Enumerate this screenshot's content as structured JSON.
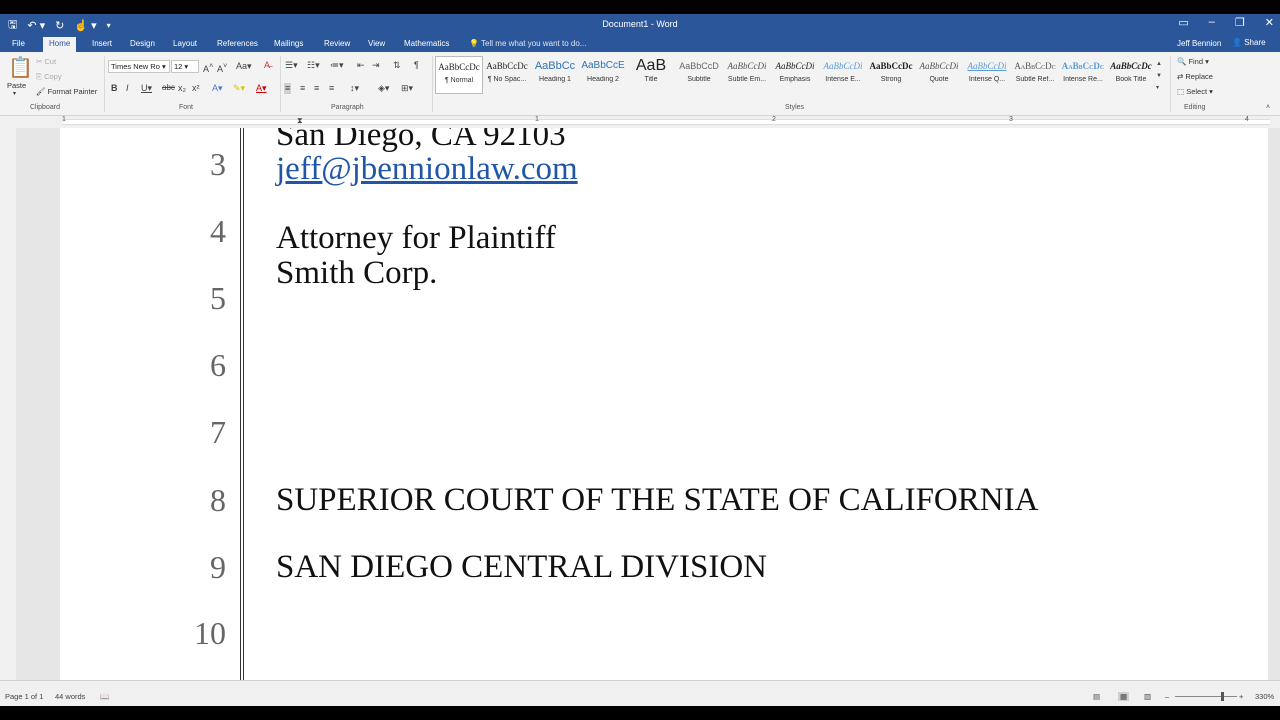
{
  "window": {
    "title": "Document1 - Word"
  },
  "tabs": [
    "File",
    "Home",
    "Insert",
    "Design",
    "Layout",
    "References",
    "Mailings",
    "Review",
    "View",
    "Mathematics"
  ],
  "tell_me": "Tell me what you want to do...",
  "user": "Jeff Bennion",
  "share": "Share",
  "clipboard": {
    "paste": "Paste",
    "cut": "Cut",
    "copy": "Copy",
    "format_painter": "Format Painter",
    "label": "Clipboard"
  },
  "font": {
    "name": "Times New Ro",
    "size": "12",
    "label": "Font"
  },
  "paragraph": {
    "label": "Paragraph"
  },
  "styles": {
    "label": "Styles",
    "items": [
      {
        "preview": "AaBbCcDc",
        "name": "¶ Normal"
      },
      {
        "preview": "AaBbCcDc",
        "name": "¶ No Spac..."
      },
      {
        "preview": "AaBbCc",
        "name": "Heading 1"
      },
      {
        "preview": "AaBbCcE",
        "name": "Heading 2"
      },
      {
        "preview": "AaB",
        "name": "Title"
      },
      {
        "preview": "AaBbCcD",
        "name": "Subtitle"
      },
      {
        "preview": "AaBbCcDi",
        "name": "Subtle Em..."
      },
      {
        "preview": "AaBbCcDi",
        "name": "Emphasis"
      },
      {
        "preview": "AaBbCcDi",
        "name": "Intense E..."
      },
      {
        "preview": "AaBbCcDc",
        "name": "Strong"
      },
      {
        "preview": "AaBbCcDi",
        "name": "Quote"
      },
      {
        "preview": "AaBbCcDi",
        "name": "Intense Q..."
      },
      {
        "preview": "AaBbCcDc",
        "name": "Subtle Ref..."
      },
      {
        "preview": "AaBbCcDc",
        "name": "Intense Re..."
      },
      {
        "preview": "AaBbCcDc",
        "name": "Book Title"
      }
    ]
  },
  "editing": {
    "find": "Find",
    "replace": "Replace",
    "select": "Select",
    "label": "Editing"
  },
  "ruler": {
    "marks": [
      "1",
      "1",
      "2",
      "3",
      "4"
    ]
  },
  "document": {
    "line_numbers": [
      "3",
      "4",
      "5",
      "6",
      "7",
      "8",
      "9",
      "10"
    ],
    "lines": {
      "address": "San Diego, CA 92103",
      "email": "jeff@jbennionlaw.com",
      "attorney": "Attorney for Plaintiff",
      "client": "Smith Corp.",
      "court": "SUPERIOR COURT OF THE STATE OF CALIFORNIA",
      "division": "SAN DIEGO CENTRAL DIVISION"
    }
  },
  "status": {
    "page": "Page 1 of 1",
    "words": "44 words",
    "zoom": "330%"
  },
  "colors": {
    "ribbon_blue": "#2b579a",
    "link": "#1f56a8"
  }
}
